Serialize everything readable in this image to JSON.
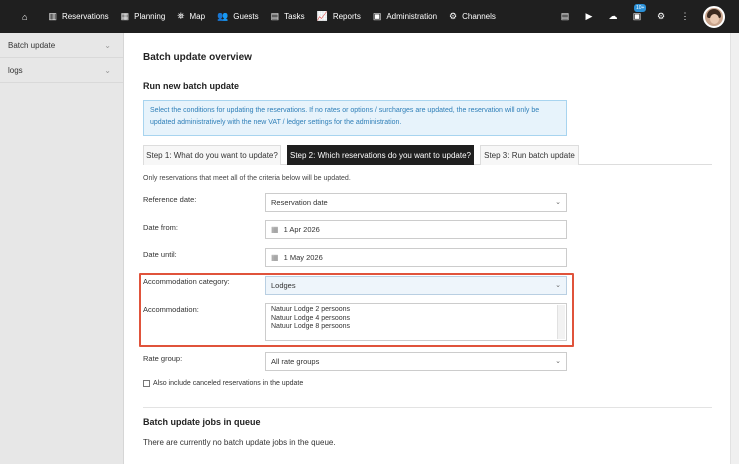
{
  "nav": {
    "items": [
      {
        "label": "Reservations",
        "icon": "reservations-icon",
        "glyph": "▥"
      },
      {
        "label": "Planning",
        "icon": "calendar-icon",
        "glyph": "▦"
      },
      {
        "label": "Map",
        "icon": "map-icon",
        "glyph": "⛯"
      },
      {
        "label": "Guests",
        "icon": "guests-icon",
        "glyph": "👥"
      },
      {
        "label": "Tasks",
        "icon": "tasks-icon",
        "glyph": "▤"
      },
      {
        "label": "Reports",
        "icon": "reports-icon",
        "glyph": "📈"
      },
      {
        "label": "Administration",
        "icon": "administration-icon",
        "glyph": "▣"
      },
      {
        "label": "Channels",
        "icon": "channels-icon",
        "glyph": "⚙"
      }
    ],
    "badge": "10+"
  },
  "sidebar": {
    "items": [
      {
        "label": "Batch update"
      },
      {
        "label": "logs"
      }
    ]
  },
  "page": {
    "title": "Batch update overview",
    "section_title": "Run new batch update",
    "info_text": "Select the conditions for updating the reservations. If no rates or options / surcharges are updated, the reservation will only be updated administratively with the new VAT / ledger settings for the administration.",
    "tabs": [
      {
        "label": "Step 1: What do you want to update?"
      },
      {
        "label": "Step 2: Which reservations do you want to update?"
      },
      {
        "label": "Step 3: Run batch update"
      }
    ],
    "note": "Only reservations that meet all of the criteria below will be updated.",
    "fields": {
      "reference_date_label": "Reference date:",
      "reference_date_value": "Reservation date",
      "date_from_label": "Date from:",
      "date_from_value": "1 Apr 2026",
      "date_until_label": "Date until:",
      "date_until_value": "1 May 2026",
      "accommodation_category_label": "Accommodation category:",
      "accommodation_category_value": "Lodges",
      "accommodation_label": "Accommodation:",
      "accommodation_options": [
        "Natuur Lodge 2 persoons",
        "Natuur Lodge 4 persoons",
        "Natuur Lodge 8 persoons"
      ],
      "rate_group_label": "Rate group:",
      "rate_group_value": "All rate groups"
    },
    "include_canceled_label": "Also include canceled reservations in the update",
    "queue_title": "Batch update jobs in queue",
    "queue_empty": "There are currently no batch update jobs in the queue."
  },
  "colors": {
    "topbar": "#1f1f1f",
    "highlight_border": "#e0533b",
    "info_bg": "#e7f3fb",
    "info_text": "#2f7fb8",
    "active_tab": "#1f1f1f"
  }
}
